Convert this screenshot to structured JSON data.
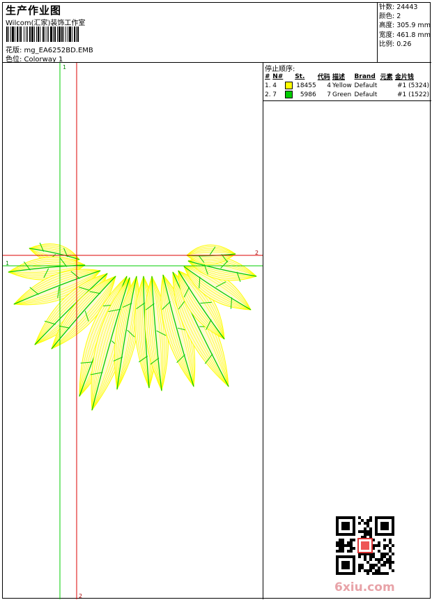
{
  "header": {
    "title": "生产作业图",
    "company": "Wilcom(汇家)装饰工作室",
    "design_label": "花版: mg_EA6252BD.EMB",
    "colorway_label": "色位: Colorway 1"
  },
  "stats": {
    "stitches": "针数: 24443",
    "colors": "颜色: 2",
    "height": "高度: 305.9 mm",
    "width": "宽度: 461.8 mm",
    "scale": "比例: 0.26"
  },
  "guides": {
    "green_vertical_label": "1",
    "green_horizontal_label": "1",
    "red_horizontal_label": "2",
    "red_vertical_label": "2"
  },
  "sequence": {
    "title": "停止顺序:",
    "columns": [
      "#",
      "N#",
      "St.",
      "代码",
      "描述",
      "Brand",
      "元素",
      "金片钱"
    ],
    "rows": [
      {
        "index": "1.",
        "needle": "4",
        "color": "#ffff00",
        "stitches": "18455",
        "code": "4",
        "desc": "Yellow",
        "brand": "Default",
        "element": "",
        "sequin": "#1 (5324)"
      },
      {
        "index": "2.",
        "needle": "7",
        "color": "#00cc00",
        "stitches": "5986",
        "code": "7",
        "desc": "Green",
        "brand": "Default",
        "element": "",
        "sequin": "#1 (1522)"
      }
    ]
  },
  "watermark": {
    "site": "6xiu.com"
  },
  "colors": {
    "thread_yellow": "#ffff00",
    "thread_green": "#00cc00",
    "guide_green": "#00cc00",
    "guide_red": "#dd0000"
  }
}
